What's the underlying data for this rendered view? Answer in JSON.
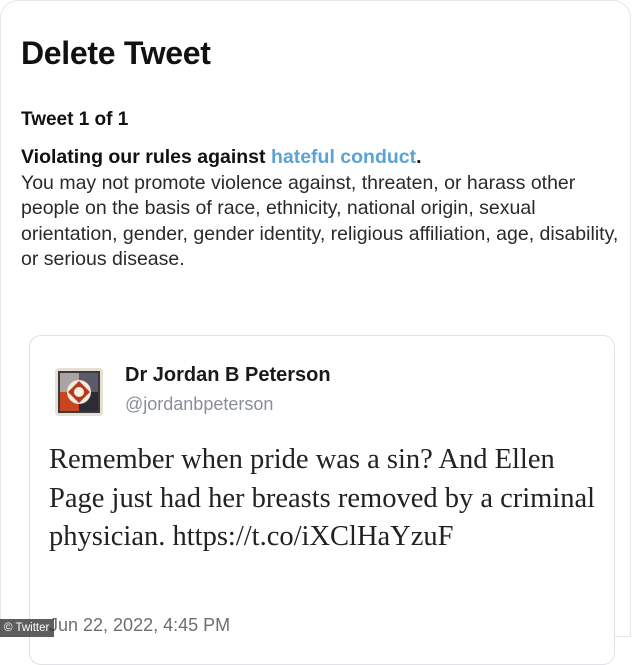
{
  "dialog": {
    "title": "Delete Tweet",
    "counter": "Tweet 1 of 1"
  },
  "rule": {
    "heading_prefix": "Violating our rules against ",
    "heading_link": "hateful conduct",
    "heading_suffix": ".",
    "body": "You may not promote violence against, threaten, or harass other people on the basis of race, ethnicity, national origin, sexual orientation, gender, gender identity, religious affiliation, age, disability, or serious disease.",
    "link_color": "#5aa4d4"
  },
  "tweet": {
    "display_name": "Dr Jordan B Peterson",
    "handle": "@jordanbpeterson",
    "text": "Remember when pride was a sin? And Ellen Page just had her breasts removed by a criminal physician. https://t.co/iXClHaYzuF",
    "timestamp": "Jun 22, 2022, 4:45 PM",
    "avatar_icon": "profile-avatar-icon"
  },
  "credit": "© Twitter"
}
